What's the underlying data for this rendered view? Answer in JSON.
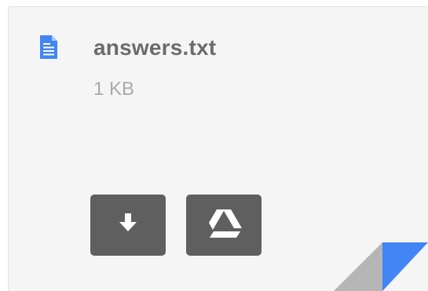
{
  "file": {
    "name": "answers.txt",
    "size": "1 KB",
    "type_icon": "text-document-icon"
  },
  "actions": {
    "download_icon": "download-arrow-icon",
    "drive_icon": "google-drive-icon"
  },
  "colors": {
    "card_background": "#f5f5f5",
    "file_icon": "#4285f4",
    "button_background": "#5f5f5f",
    "name_text": "#6b6b6b",
    "size_text": "#a9a9a9",
    "corner_fold_blue": "#4285f4",
    "corner_fold_gray": "#b5b5b5"
  }
}
